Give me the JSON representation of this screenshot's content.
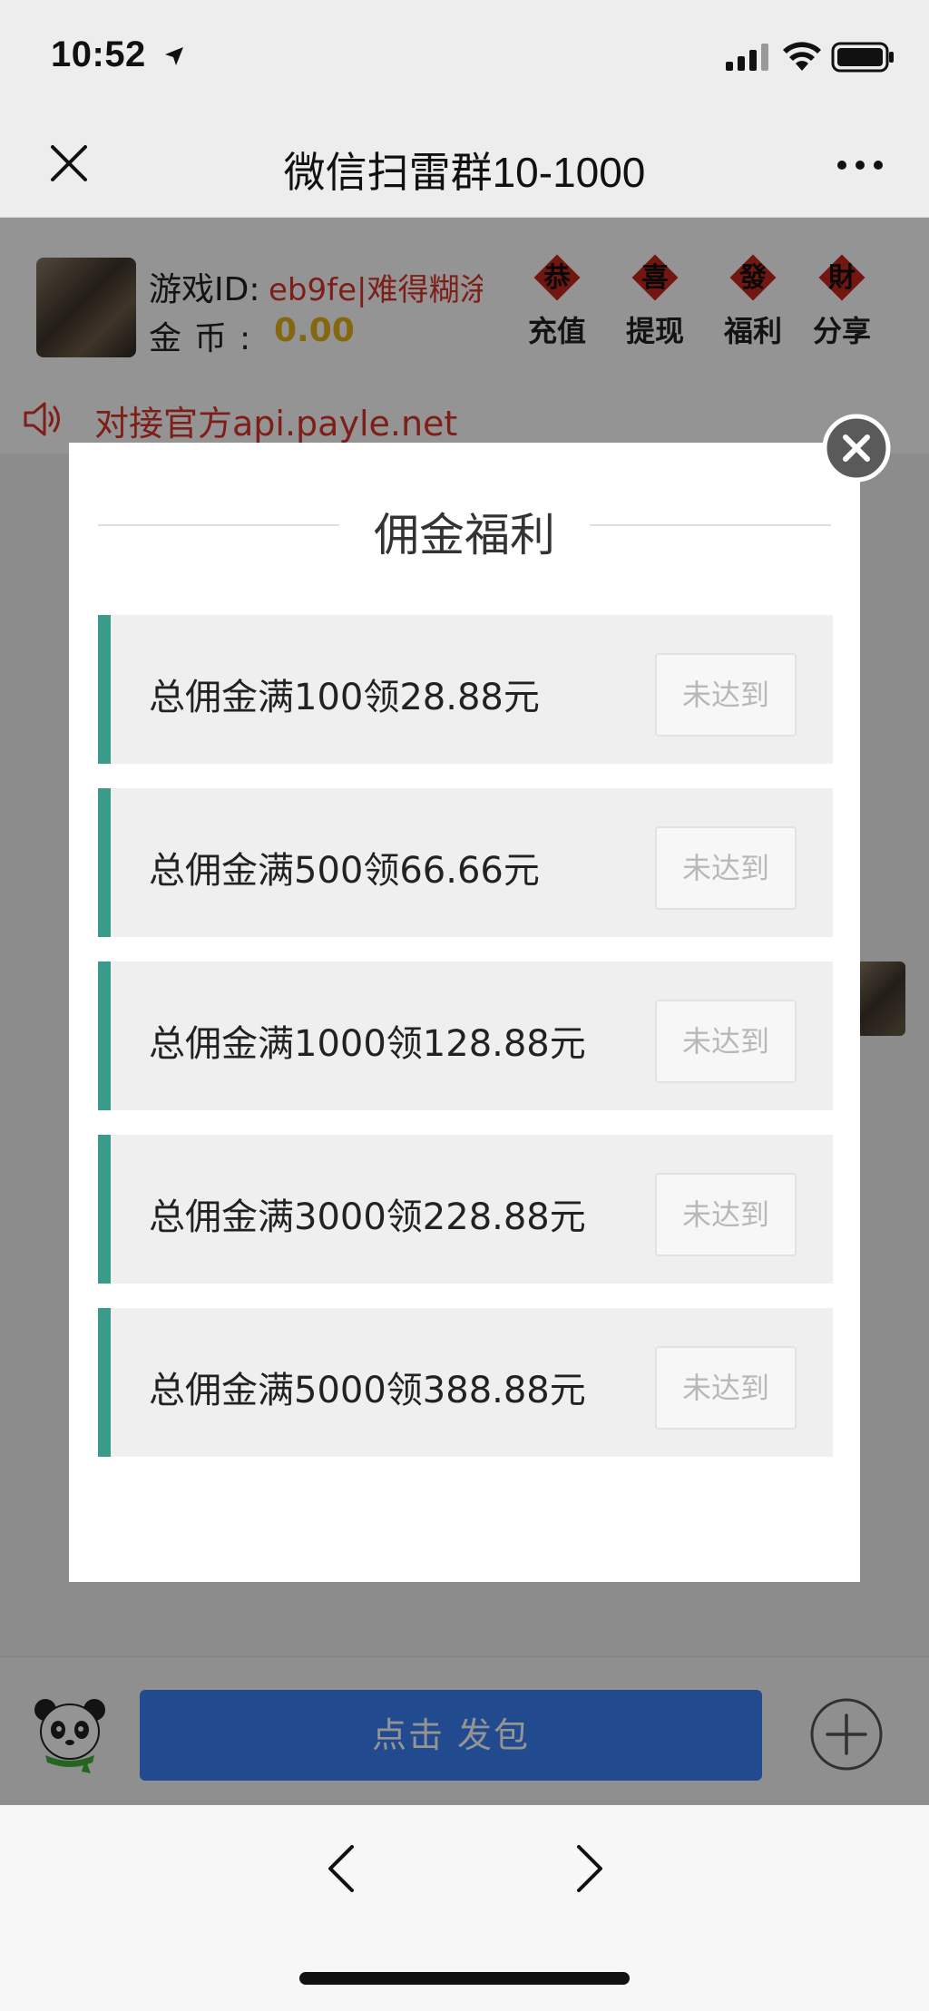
{
  "status_bar": {
    "time": "10:52"
  },
  "nav": {
    "title": "微信扫雷群10-1000"
  },
  "game": {
    "id_label": "游戏ID:",
    "id_value": "eb9fe|难得糊涂",
    "coin_label": "金币:",
    "coin_value": "0.00",
    "actions": [
      {
        "badge": "恭",
        "label": "充值"
      },
      {
        "badge": "喜",
        "label": "提现"
      },
      {
        "badge": "發",
        "label": "福利"
      },
      {
        "badge": "財",
        "label": "分享"
      }
    ]
  },
  "notice": {
    "text": "对接官方api.payle.net"
  },
  "modal": {
    "title": "佣金福利",
    "items": [
      {
        "text": "总佣金满100领28.88元",
        "button": "未达到"
      },
      {
        "text": "总佣金满500领66.66元",
        "button": "未达到"
      },
      {
        "text": "总佣金满1000领128.88元",
        "button": "未达到"
      },
      {
        "text": "总佣金满3000领228.88元",
        "button": "未达到"
      },
      {
        "text": "总佣金满5000领388.88元",
        "button": "未达到"
      }
    ]
  },
  "input_bar": {
    "send_label": "点击 发包"
  },
  "colors": {
    "accent": "#3a9b8a",
    "send_button": "#3b82f6",
    "warn_text": "#d9342b",
    "coin": "#e3b21a"
  },
  "icons": [
    "location-arrow-icon",
    "signal-icon",
    "wifi-icon",
    "battery-icon",
    "close-icon",
    "more-icon",
    "speaker-icon",
    "panda-icon",
    "plus-icon",
    "back-icon",
    "forward-icon"
  ]
}
